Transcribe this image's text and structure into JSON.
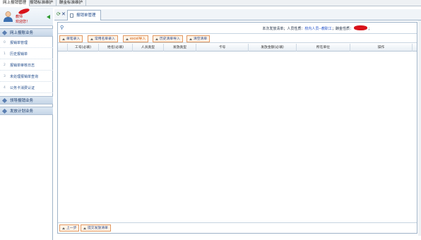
{
  "top_menu": [
    "网上报销管理",
    "报销标准维护",
    "酬金标准维护"
  ],
  "user": {
    "greeting_name": "教师",
    "welcome": "欢迎您！"
  },
  "sidebar": {
    "section_main": "网上报账业务",
    "items": [
      {
        "num": "0",
        "label": "报销单管理"
      },
      {
        "num": "1",
        "label": "历史报销单"
      },
      {
        "num": "2",
        "label": "报销单审核日志"
      },
      {
        "num": "3",
        "label": "未处理报销单查询"
      },
      {
        "num": "4",
        "label": "公务卡消费认证"
      }
    ],
    "section_2": "领导报销业务",
    "section_3": "发放计划业务"
  },
  "tab": {
    "refresh_icon": "refresh-icon",
    "close_icon": "close-icon",
    "label": "报销单管理"
  },
  "info": {
    "prefix": "本次发放清单；人员性质：",
    "person_type": "校内人员--教职工",
    "middle": "；酬金性质：",
    "suffix": "；"
  },
  "toolbar": {
    "buttons": [
      "单笔录入",
      "常用名单录入",
      "excel导入",
      "历史清单导入",
      "清空清单"
    ]
  },
  "table": {
    "columns": [
      "",
      "工号(必填)",
      "姓名(必填)",
      "人员类型",
      "发放类型",
      "卡号",
      "发放金额(必填)",
      "所在单位",
      "操作"
    ]
  },
  "bottom": {
    "prev": "上一步",
    "submit": "提交发放清单"
  },
  "colors": {
    "accent_blue": "#1f4a8a",
    "button_border": "#e29860",
    "redaction": "#d8121a"
  }
}
